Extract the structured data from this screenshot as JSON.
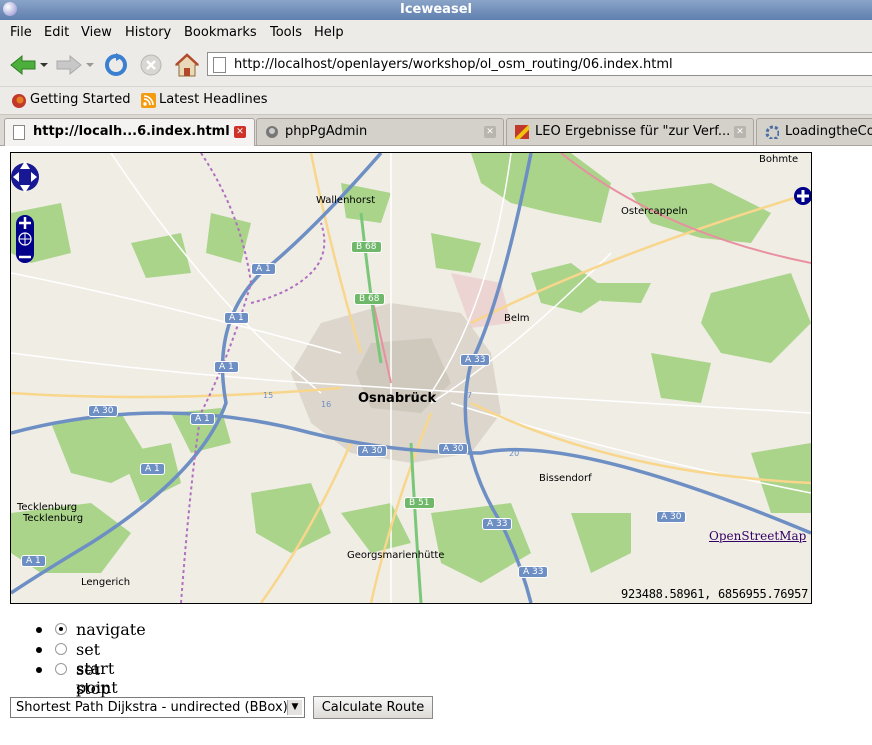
{
  "window": {
    "title": "Iceweasel"
  },
  "menu": [
    "File",
    "Edit",
    "View",
    "History",
    "Bookmarks",
    "Tools",
    "Help"
  ],
  "navigation": {
    "url": "http://localhost/openlayers/workshop/ol_osm_routing/06.index.html"
  },
  "bookmarks": [
    {
      "label": "Getting Started",
      "icon": "firefox-icon"
    },
    {
      "label": "Latest Headlines",
      "icon": "rss-icon"
    }
  ],
  "tabs": [
    {
      "label": "http://localh...6.index.html",
      "active": true,
      "icon": "page-icon"
    },
    {
      "label": "phpPgAdmin",
      "active": false,
      "icon": "elephant-icon"
    },
    {
      "label": "LEO Ergebnisse für \"zur Verf...",
      "active": false,
      "icon": "leo-icon"
    },
    {
      "label": "LoadingtheCo",
      "active": false,
      "icon": "gear-icon"
    }
  ],
  "map": {
    "places": {
      "osnabrueck": "Osnabrück",
      "wallenhorst": "Wallenhorst",
      "bohmte": "Bohmte",
      "ostercappeln": "Ostercappeln",
      "belm": "Belm",
      "bissendorf": "Bissendorf",
      "georgsmarienhuette": "Georgsmarienhütte",
      "tecklenburg1": "Tecklenburg",
      "tecklenburg2": "Tecklenburg",
      "lengerich": "Lengerich"
    },
    "shields": {
      "b68a": "B 68",
      "b68b": "B 68",
      "b51": "B 51",
      "a1a": "A 1",
      "a1b": "A 1",
      "a1c": "A 1",
      "a1d": "A 1",
      "a1e": "A 1",
      "a1f": "A 1",
      "a30a": "A 30",
      "a30b": "A 30",
      "a30c": "A 30",
      "a30d": "A 30",
      "a33a": "A 33",
      "a33b": "A 33",
      "a33c": "A 33"
    },
    "junctions": {
      "j15": "15",
      "j16": "16",
      "j7": "7",
      "j20": "20"
    },
    "attribution": "OpenStreetMap",
    "coordinates": "923488.58961, 6856955.76957"
  },
  "controls": {
    "modes": [
      {
        "label": "navigate",
        "checked": true
      },
      {
        "label": "set start point",
        "checked": false
      },
      {
        "label": "set stop point",
        "checked": false
      }
    ],
    "algorithm": "Shortest Path Dijkstra - undirected (BBox)",
    "calculate": "Calculate Route"
  }
}
